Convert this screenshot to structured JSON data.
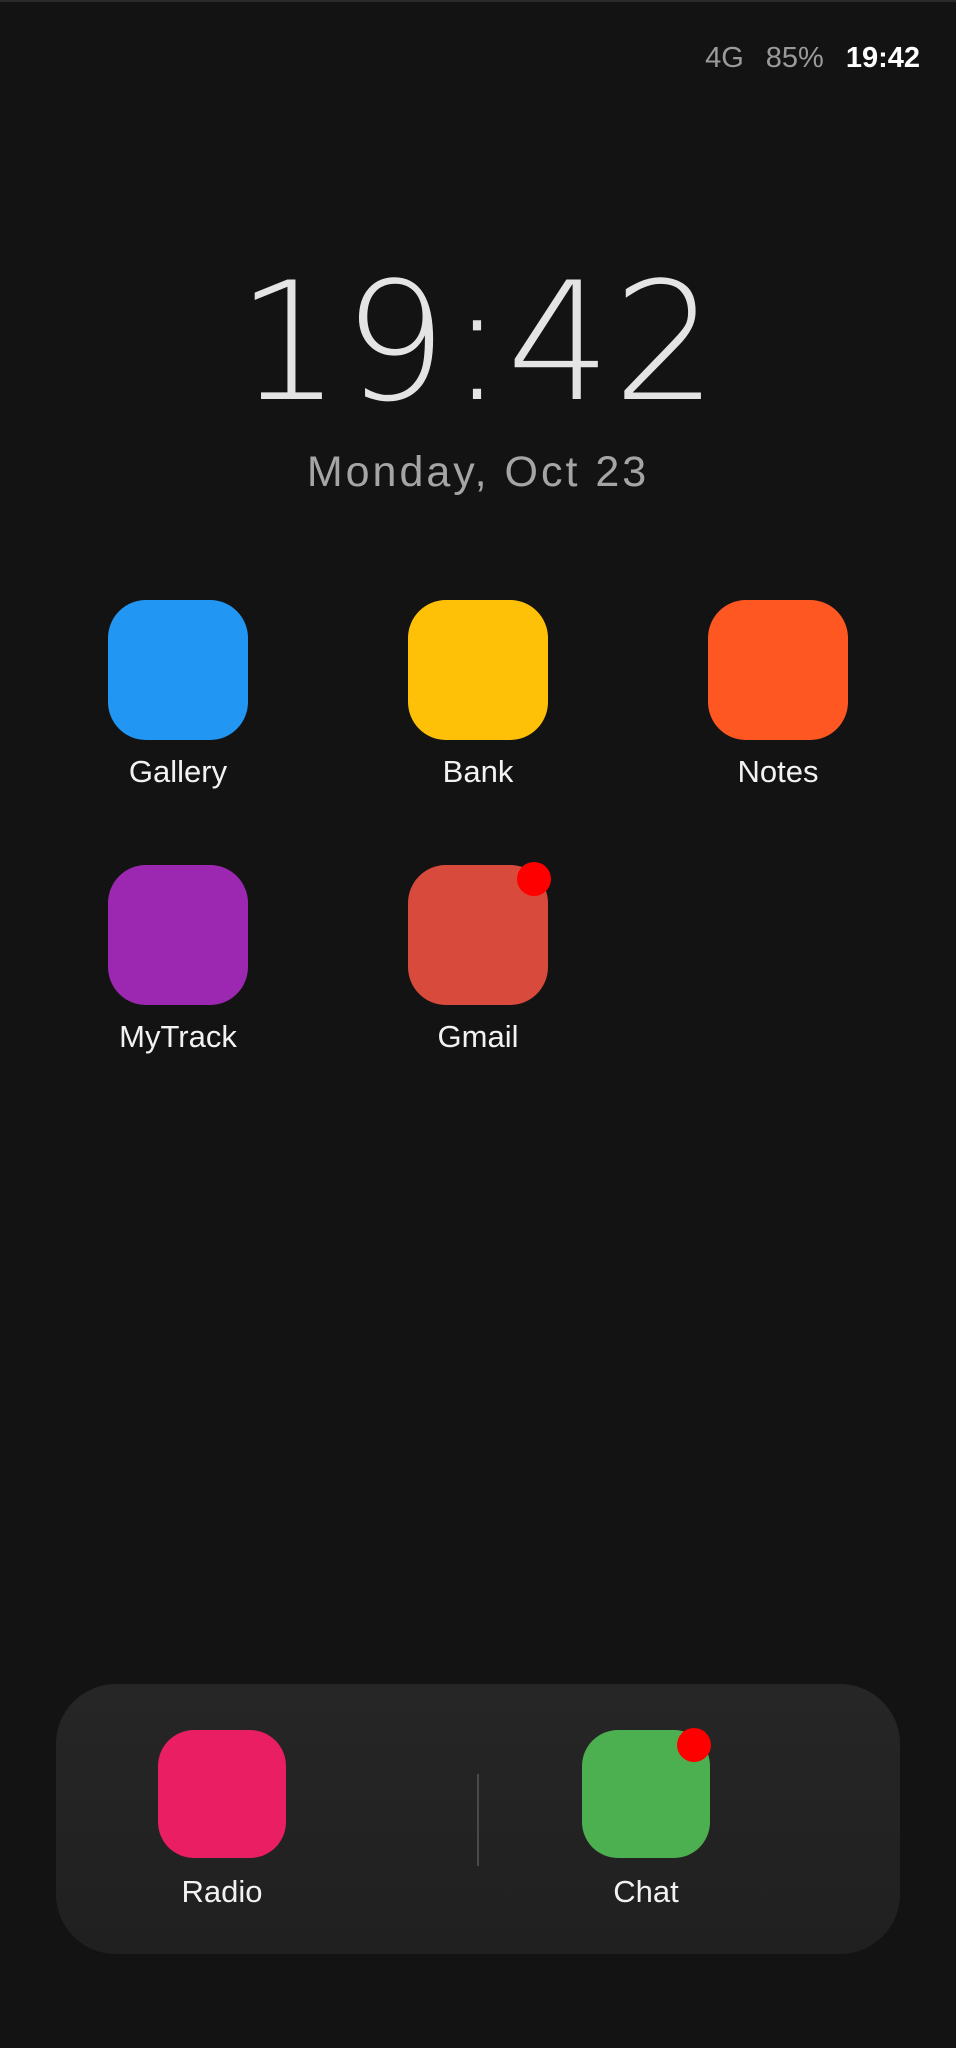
{
  "status_bar": {
    "network": "4G",
    "battery": "85%",
    "time": "19:42"
  },
  "lock_clock": {
    "time": "19:42",
    "date": "Monday, Oct 23"
  },
  "apps": [
    {
      "label": "Gallery",
      "color": "#2196F3",
      "has_badge": false,
      "icon": "gallery-icon"
    },
    {
      "label": "Bank",
      "color": "#FFC107",
      "has_badge": false,
      "icon": "bank-icon"
    },
    {
      "label": "Notes",
      "color": "#FF5722",
      "has_badge": false,
      "icon": "notes-icon"
    },
    {
      "label": "MyTrack",
      "color": "#9C27B0",
      "has_badge": false,
      "icon": "mytrack-icon"
    },
    {
      "label": "Gmail",
      "color": "#D84B3C",
      "has_badge": true,
      "icon": "gmail-icon"
    }
  ],
  "dock": {
    "apps": [
      {
        "label": "Radio",
        "color": "#E91E63",
        "has_badge": false,
        "icon": "radio-icon"
      },
      {
        "label": "Chat",
        "color": "#4CAF50",
        "has_badge": true,
        "icon": "chat-icon"
      }
    ]
  },
  "colors": {
    "background": "#131313",
    "badge": "#FF0000",
    "dock_background": "#232323"
  }
}
